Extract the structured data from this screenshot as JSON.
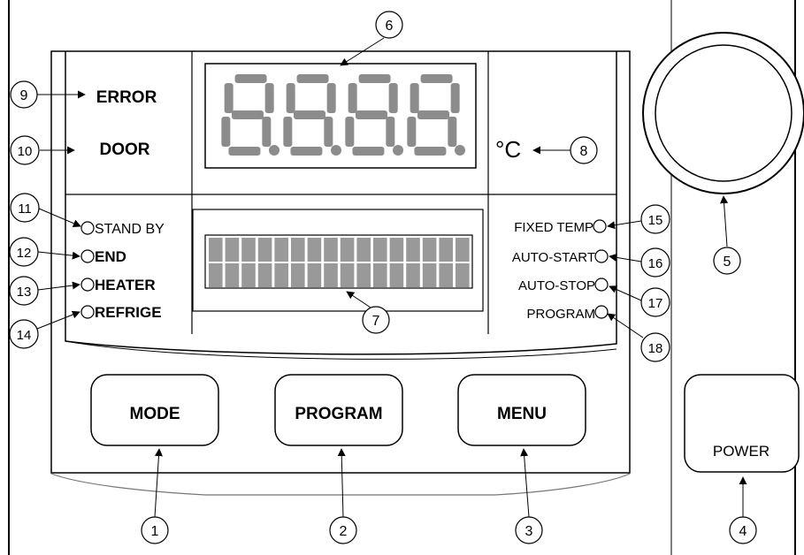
{
  "indicators_left": {
    "error": "ERROR",
    "door": "DOOR",
    "standby": "STAND BY",
    "end": "END",
    "heater": "HEATER",
    "refrige": "REFRIGE"
  },
  "indicators_right": {
    "fixed_temp": "FIXED TEMP",
    "auto_start": "AUTO-START",
    "auto_stop": "AUTO-STOP",
    "program": "PROGRAM"
  },
  "unit": "°C",
  "buttons": {
    "mode": "MODE",
    "program": "PROGRAM",
    "menu": "MENU",
    "power": "POWER"
  },
  "callouts": {
    "n1": "1",
    "n2": "2",
    "n3": "3",
    "n4": "4",
    "n5": "5",
    "n6": "6",
    "n7": "7",
    "n8": "8",
    "n9": "9",
    "n10": "10",
    "n11": "11",
    "n12": "12",
    "n13": "13",
    "n14": "14",
    "n15": "15",
    "n16": "16",
    "n17": "17",
    "n18": "18"
  },
  "colors": {
    "segment": "#8c8c8c",
    "lcd_cell": "#999999",
    "line": "#000000"
  }
}
